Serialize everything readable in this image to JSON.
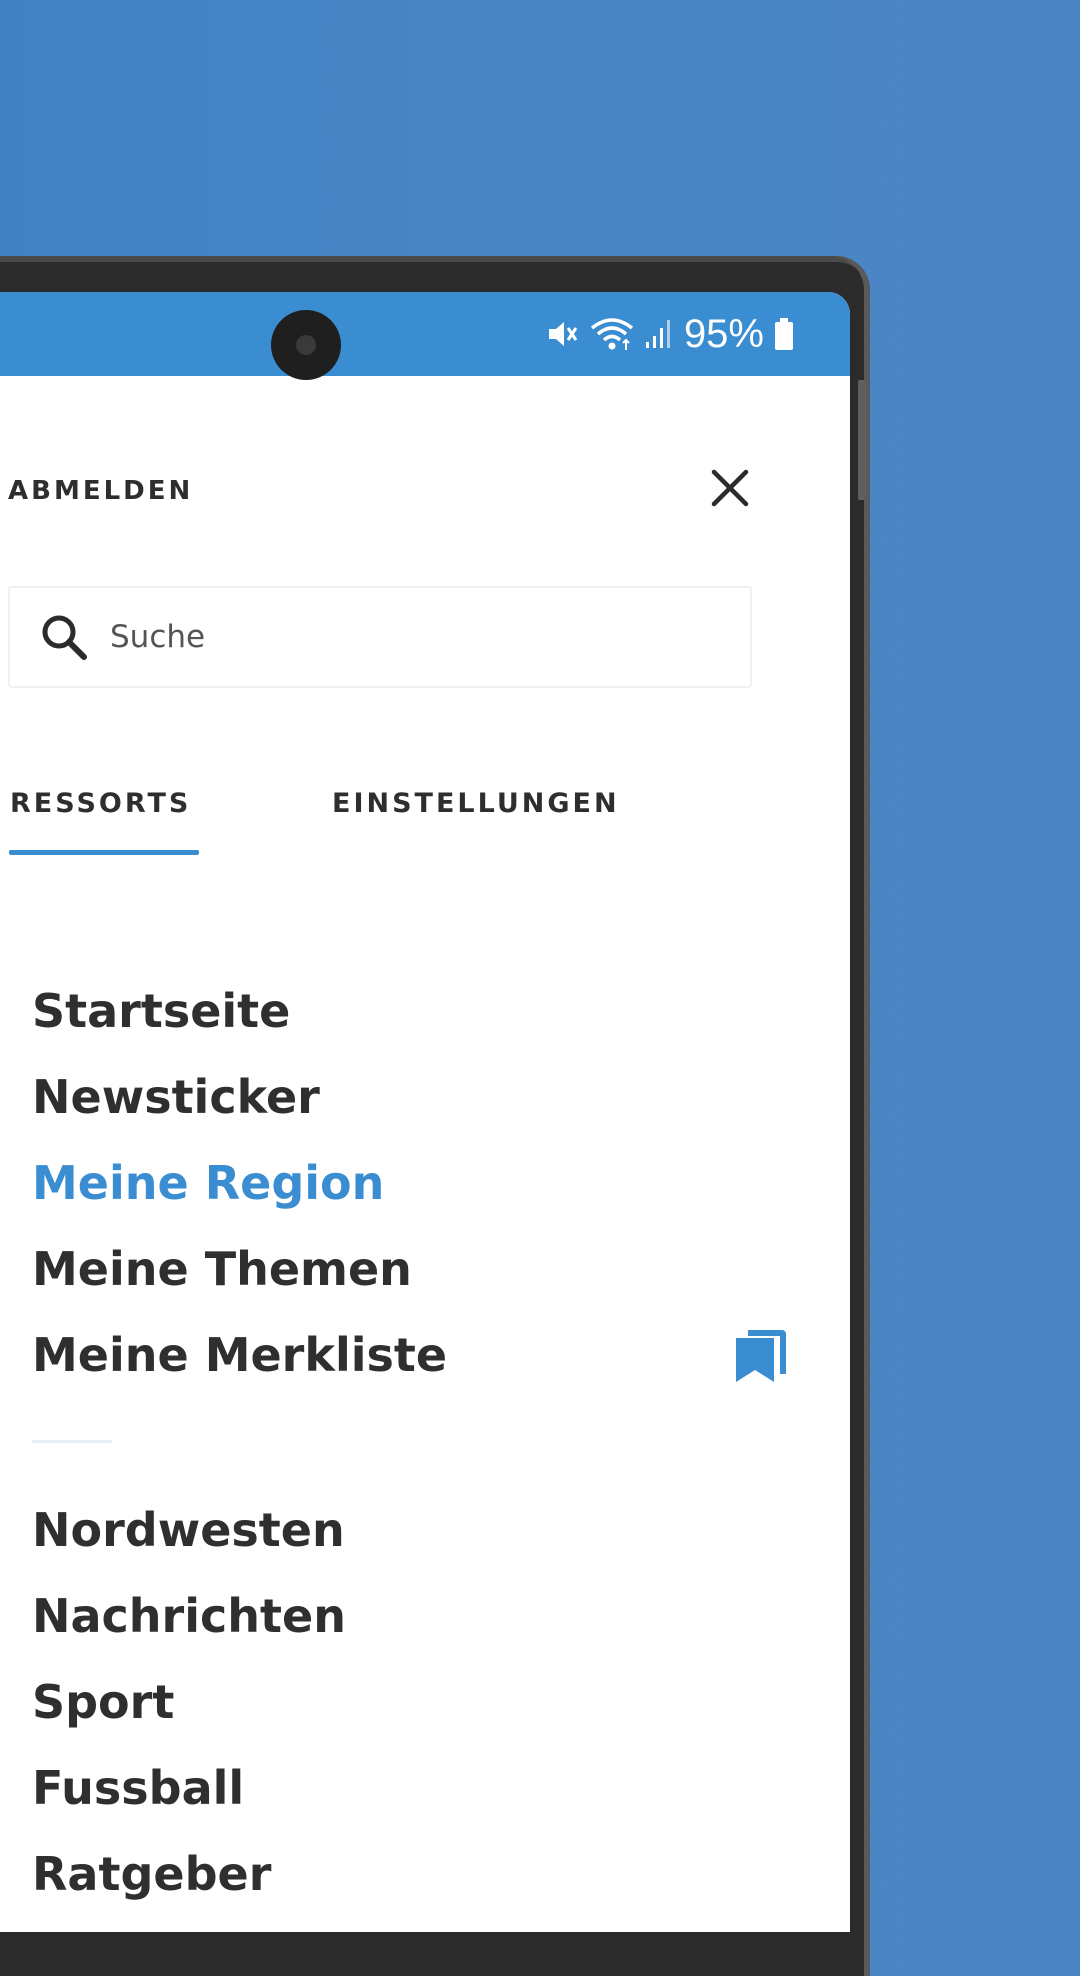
{
  "status_bar": {
    "battery_percent": "95%",
    "icons": [
      "mute-icon",
      "wifi-icon",
      "signal-icon",
      "battery-icon"
    ]
  },
  "header": {
    "logout_label": "ABMELDEN",
    "close_icon": "close-icon"
  },
  "search": {
    "placeholder": "Suche",
    "icon": "search-icon"
  },
  "tabs": [
    {
      "label": "RESSORTS",
      "active": true
    },
    {
      "label": "EINSTELLUNGEN",
      "active": false
    }
  ],
  "menu": {
    "primary": [
      {
        "label": "Startseite"
      },
      {
        "label": "Newsticker"
      },
      {
        "label": "Meine Region",
        "active": true
      },
      {
        "label": "Meine Themen"
      },
      {
        "label": "Meine Merkliste",
        "icon": "bookmark-icon"
      }
    ],
    "secondary": [
      {
        "label": "Nordwesten"
      },
      {
        "label": "Nachrichten"
      },
      {
        "label": "Sport"
      },
      {
        "label": "Fussball"
      },
      {
        "label": "Ratgeber"
      }
    ]
  },
  "colors": {
    "accent": "#3a8dd1",
    "background": "#4a86c6",
    "text": "#2f2f2f"
  }
}
